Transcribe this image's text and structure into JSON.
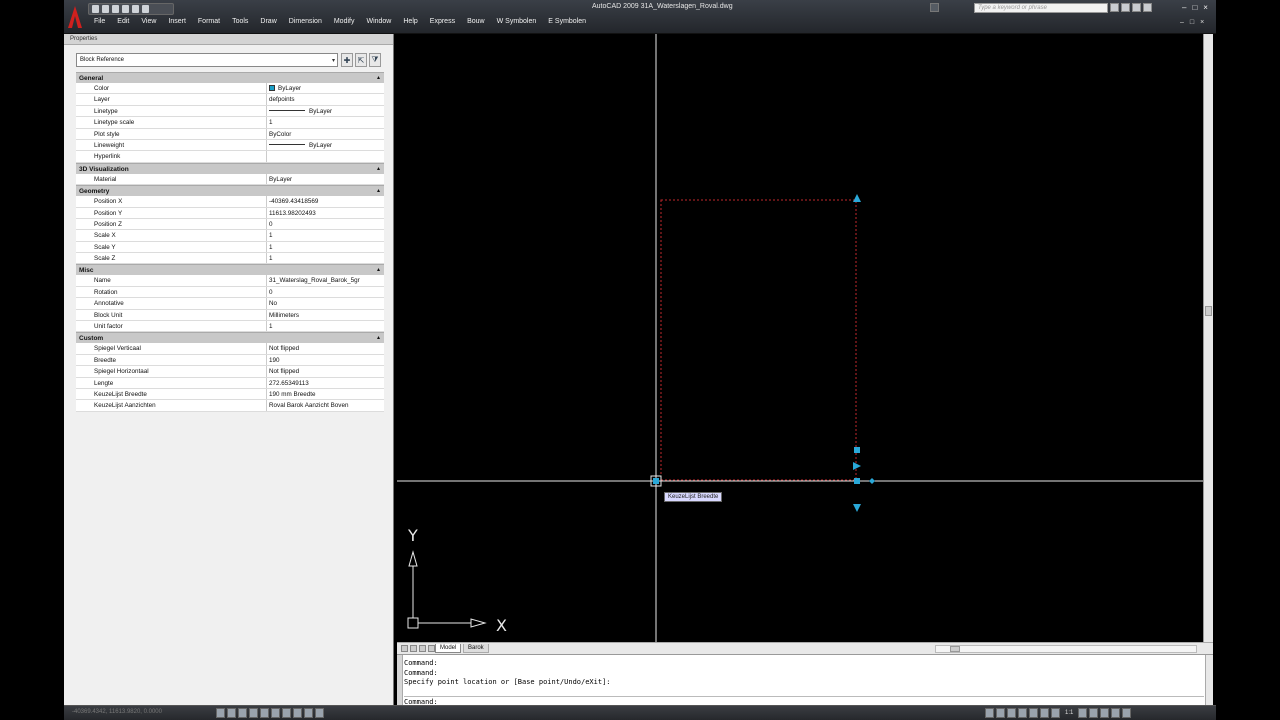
{
  "window": {
    "title": "AutoCAD 2009   31A_Waterslagen_Roval.dwg",
    "search_placeholder": "Type a keyword or phrase",
    "controls": [
      "–",
      "□",
      "×"
    ]
  },
  "menu": [
    "File",
    "Edit",
    "View",
    "Insert",
    "Format",
    "Tools",
    "Draw",
    "Dimension",
    "Modify",
    "Window",
    "Help",
    "Express",
    "Bouw",
    "W Symbolen",
    "E Symbolen"
  ],
  "properties": {
    "panel_title": "Properties",
    "selector": "Block Reference",
    "categories": [
      {
        "name": "General",
        "rows": [
          {
            "k": "Color",
            "v": "ByLayer"
          },
          {
            "k": "Layer",
            "v": "defpoints"
          },
          {
            "k": "Linetype",
            "v": "ByLayer"
          },
          {
            "k": "Linetype scale",
            "v": "1"
          },
          {
            "k": "Plot style",
            "v": "ByColor"
          },
          {
            "k": "Lineweight",
            "v": "ByLayer"
          },
          {
            "k": "Hyperlink",
            "v": ""
          }
        ]
      },
      {
        "name": "3D Visualization",
        "rows": [
          {
            "k": "Material",
            "v": "ByLayer"
          }
        ]
      },
      {
        "name": "Geometry",
        "rows": [
          {
            "k": "Position X",
            "v": "-40369.43418569"
          },
          {
            "k": "Position Y",
            "v": "11613.98202493"
          },
          {
            "k": "Position Z",
            "v": "0"
          },
          {
            "k": "Scale X",
            "v": "1"
          },
          {
            "k": "Scale Y",
            "v": "1"
          },
          {
            "k": "Scale Z",
            "v": "1"
          }
        ]
      },
      {
        "name": "Misc",
        "rows": [
          {
            "k": "Name",
            "v": "31_Waterslag_Roval_Barok_5gr"
          },
          {
            "k": "Rotation",
            "v": "0"
          },
          {
            "k": "Annotative",
            "v": "No"
          },
          {
            "k": "Block Unit",
            "v": "Millimeters"
          },
          {
            "k": "Unit factor",
            "v": "1"
          }
        ]
      },
      {
        "name": "Custom",
        "rows": [
          {
            "k": "Spiegel Verticaal",
            "v": "Not flipped"
          },
          {
            "k": "Breedte",
            "v": "190"
          },
          {
            "k": "Spiegel Horizontaal",
            "v": "Not flipped"
          },
          {
            "k": "Lengte",
            "v": "272.65349113"
          },
          {
            "k": "KeuzeLijst Breedte",
            "v": "190 mm Breedte"
          },
          {
            "k": "KeuzeLijst Aanzichten",
            "v": "Roval Barok Aanzicht Boven"
          }
        ]
      }
    ]
  },
  "canvas": {
    "tooltip": "KeuzeLijst Breedte",
    "ucs_x": "X",
    "ucs_y": "Y",
    "block_color": "#c0282b",
    "grip_color": "#2aa8d8"
  },
  "tabs": {
    "model": "Model",
    "layout": "Barok"
  },
  "command": {
    "history": [
      "Command:",
      "Command:",
      "Specify point location or [Base point/Undo/eXit]:"
    ],
    "prompt": "Command:"
  },
  "status": {
    "coords": "-40369.4342, 11613.9820, 0.0000",
    "annoscale": "1:1"
  }
}
